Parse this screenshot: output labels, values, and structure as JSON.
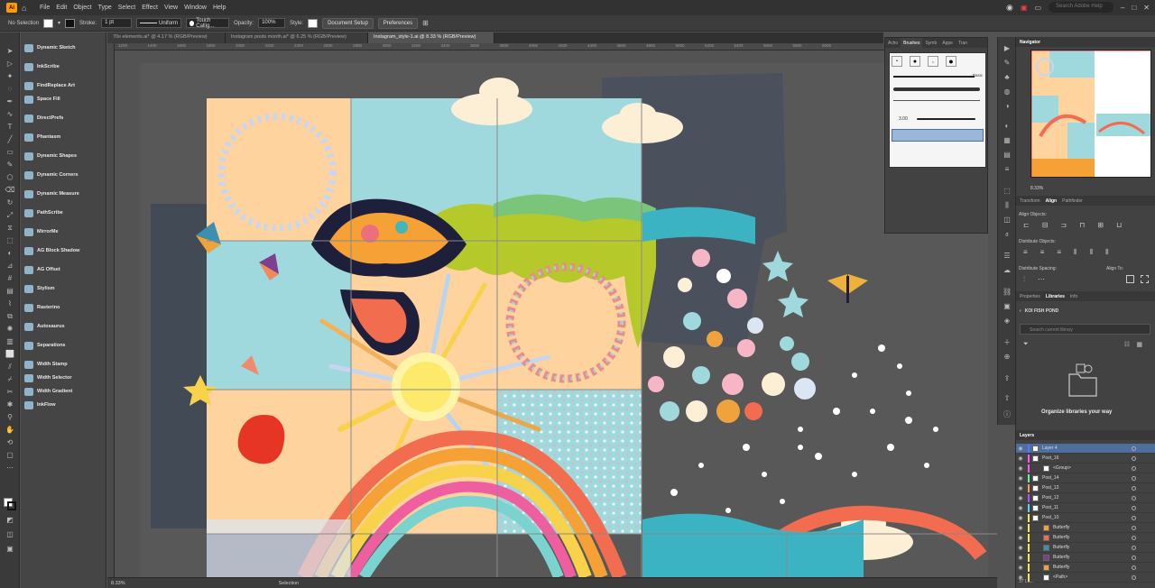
{
  "menubar": {
    "logo": "Ai",
    "items": [
      "File",
      "Edit",
      "Object",
      "Type",
      "Select",
      "Effect",
      "View",
      "Window",
      "Help"
    ],
    "search_placeholder": "Search Adobe Help"
  },
  "control_bar": {
    "selection_label": "No Selection",
    "stroke_label": "Stroke:",
    "stroke_value": "1 pt",
    "uniform_label": "Uniform",
    "brush_name": "Touch Callig...",
    "opacity_label": "Opacity:",
    "opacity_value": "100%",
    "style_label": "Style:",
    "document_setup": "Document Setup",
    "preferences": "Preferences"
  },
  "doc_tabs": [
    {
      "label": "70s elements.ai* @ 4.17 % (RGB/Preview)",
      "active": false
    },
    {
      "label": "Instagram posts month.ai* @ 6.25 % (RGB/Preview)",
      "active": false
    },
    {
      "label": "Instagram_style-1.ai @ 8.33 % (RGB/Preview)",
      "active": true
    }
  ],
  "ruler_ticks": [
    "1200",
    "1400",
    "1600",
    "1800",
    "2000",
    "2200",
    "2400",
    "2600",
    "2800",
    "3000",
    "3200",
    "3400",
    "3600",
    "3800",
    "4000",
    "4200",
    "4400",
    "4600",
    "4800",
    "5000",
    "5200",
    "5400",
    "5600",
    "5800",
    "6000"
  ],
  "plugins": [
    "Dynamic Sketch",
    "InkScribe",
    "FindReplace Art",
    "Space Fill",
    "DirectPrefs",
    "Phantasm",
    "Dynamic Shapes",
    "Dynamic Corners",
    "Dynamic Measure",
    "PathScribe",
    "MirrorMe",
    "AG Block Shadow",
    "AG Offset",
    "Stylism",
    "Rasterino",
    "Autosaurus",
    "Separations",
    "Width Stamp",
    "Width Selector",
    "Width Gradient",
    "InkFlow"
  ],
  "brush_panel": {
    "tabs": [
      "Actio",
      "Brushes",
      "Symb",
      "Appe",
      "Tran"
    ],
    "basic_label": "Basic",
    "size_label": "3.00"
  },
  "navigator": {
    "title": "Navigator",
    "zoom": "8.33%"
  },
  "align_panel": {
    "tabs": [
      "Transform",
      "Align",
      "Pathfinder"
    ],
    "align_objects": "Align Objects:",
    "distribute_objects": "Distribute Objects:",
    "distribute_spacing": "Distribute Spacing:",
    "align_to": "Align To:"
  },
  "libraries_panel": {
    "tabs": [
      "Properties",
      "Libraries",
      "Info"
    ],
    "library_name": "KOI FISH POND",
    "search_placeholder": "Search current library",
    "organize_text": "Organize libraries your way"
  },
  "layers_panel": {
    "title": "Layers",
    "footer": "37 La...",
    "rows": [
      {
        "name": "Layer 4",
        "color": "#4f7bff",
        "selected": true
      },
      {
        "name": "Post_16",
        "color": "#ff4fff",
        "selected": false
      },
      {
        "name": "<Group>",
        "color": "#ff4fff",
        "selected": false
      },
      {
        "name": "Post_14",
        "color": "#4fff9a",
        "selected": false
      },
      {
        "name": "Post_13",
        "color": "#ff9a4f",
        "selected": false
      },
      {
        "name": "Post_12",
        "color": "#b04fff",
        "selected": false
      },
      {
        "name": "Post_11",
        "color": "#4fd7ff",
        "selected": false
      },
      {
        "name": "Post_10",
        "color": "#ffe34f",
        "selected": false
      },
      {
        "name": "Butterfly",
        "color": "#ffe34f",
        "selected": false
      },
      {
        "name": "Butterfly",
        "color": "#ffe34f",
        "selected": false
      },
      {
        "name": "Butterfly",
        "color": "#ffe34f",
        "selected": false
      },
      {
        "name": "Butterfly",
        "color": "#ffe34f",
        "selected": false
      },
      {
        "name": "Butterfly",
        "color": "#ffe34f",
        "selected": false
      },
      {
        "name": "<Path>",
        "color": "#ffe34f",
        "selected": false
      }
    ]
  },
  "status_bar": {
    "zoom": "8.33%",
    "tool": "Selection"
  },
  "colors": {
    "accent": "#4e6f9e",
    "peach": "#ffd39e",
    "teal": "#9fd9de",
    "cream": "#fdefd6"
  }
}
